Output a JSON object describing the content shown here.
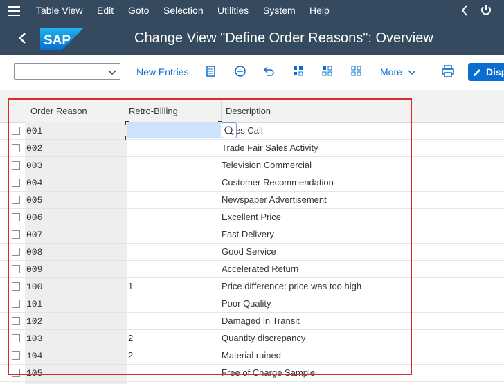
{
  "menubar": {
    "items": [
      {
        "text": "Table View",
        "u": "T"
      },
      {
        "text": "Edit",
        "u": "E"
      },
      {
        "text": "Goto",
        "u": "G"
      },
      {
        "text": "Selection",
        "u": "l"
      },
      {
        "text": "Utilities",
        "u": "i"
      },
      {
        "text": "System",
        "u": "y"
      },
      {
        "text": "Help",
        "u": "H"
      }
    ]
  },
  "titlebar": {
    "title": "Change View \"Define Order Reasons\": Overview",
    "logo_text": "SAP"
  },
  "toolbar": {
    "dropdown_value": "",
    "new_entries": "New Entries",
    "more": "More",
    "display_label": "Disp"
  },
  "table": {
    "columns": [
      "Order Reason",
      "Retro-Billing",
      "Description"
    ],
    "active_row_description_visible": "es Call",
    "rows": [
      {
        "code": "001",
        "retro": "",
        "desc": "es Call"
      },
      {
        "code": "002",
        "retro": "",
        "desc": "Trade Fair Sales Activity"
      },
      {
        "code": "003",
        "retro": "",
        "desc": "Television Commercial"
      },
      {
        "code": "004",
        "retro": "",
        "desc": "Customer Recommendation"
      },
      {
        "code": "005",
        "retro": "",
        "desc": "Newspaper Advertisement"
      },
      {
        "code": "006",
        "retro": "",
        "desc": "Excellent Price"
      },
      {
        "code": "007",
        "retro": "",
        "desc": "Fast Delivery"
      },
      {
        "code": "008",
        "retro": "",
        "desc": "Good Service"
      },
      {
        "code": "009",
        "retro": "",
        "desc": "Accelerated Return"
      },
      {
        "code": "100",
        "retro": "1",
        "desc": "Price difference: price was too high"
      },
      {
        "code": "101",
        "retro": "",
        "desc": "Poor Quality"
      },
      {
        "code": "102",
        "retro": "",
        "desc": "Damaged in Transit"
      },
      {
        "code": "103",
        "retro": "2",
        "desc": "Quantity discrepancy"
      },
      {
        "code": "104",
        "retro": "2",
        "desc": "Material ruined"
      },
      {
        "code": "105",
        "retro": "",
        "desc": "Free of Charge Sample"
      }
    ]
  },
  "colors": {
    "shell": "#354a5f",
    "accent": "#0a6ed1",
    "highlight": "#d92c2c"
  }
}
